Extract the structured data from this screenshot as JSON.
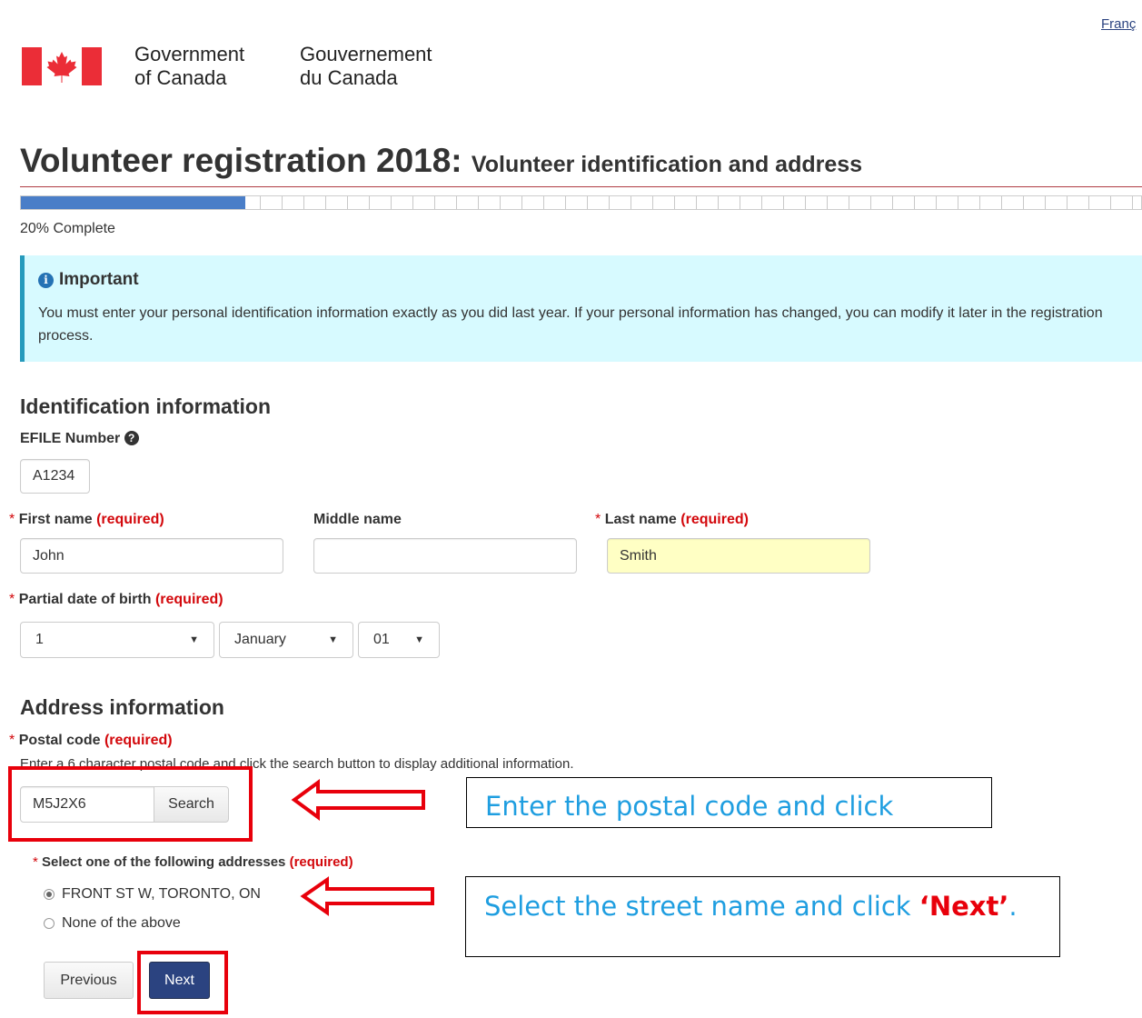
{
  "header": {
    "language_link": "Franç",
    "gov_en_line1": "Government",
    "gov_en_line2": "of Canada",
    "gov_fr_line1": "Gouvernement",
    "gov_fr_line2": "du Canada"
  },
  "page": {
    "title": "Volunteer registration 2018:",
    "subtitle": "Volunteer identification and address"
  },
  "progress": {
    "percent": 20,
    "label": "20% Complete"
  },
  "alert": {
    "icon": "info-icon",
    "heading": "Important",
    "body": "You must enter your personal identification information exactly as you did last year. If your personal information has changed, you can modify it later in the registration process."
  },
  "identification": {
    "section_title": "Identification information",
    "efile_label": "EFILE Number",
    "efile_value": "A1234",
    "required_text": "(required)",
    "first_name_label": "First name",
    "first_name_value": "John",
    "middle_name_label": "Middle name",
    "middle_name_value": "",
    "last_name_label": "Last name",
    "last_name_value": "Smith",
    "dob_label": "Partial date of birth",
    "dob_day": "1",
    "dob_month": "January",
    "dob_year": "01"
  },
  "address": {
    "section_title": "Address information",
    "postal_label": "Postal code",
    "postal_help": "Enter a 6 character postal code and click the search button to display additional information.",
    "postal_value": "M5J2X6",
    "search_button": "Search",
    "select_label": "Select one of the following addresses",
    "options": [
      "FRONT ST W, TORONTO, ON",
      "None of the above"
    ],
    "selected_index": 0
  },
  "nav": {
    "previous": "Previous",
    "next": "Next"
  },
  "annotations": {
    "callout_postal": "Enter the postal code and click",
    "callout_select_prefix": "Select the street name and click ",
    "callout_select_bold": "‘Next’",
    "callout_select_suffix": "."
  },
  "colors": {
    "required": "#d3080c",
    "primary": "#2b4380",
    "alert_bg": "#d7faff",
    "highlight_box": "#e8000b",
    "callout_text": "#1f9ee0"
  }
}
